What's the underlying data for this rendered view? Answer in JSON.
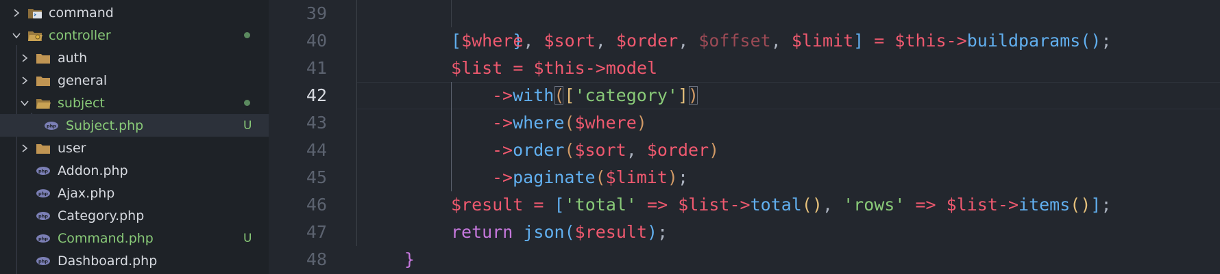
{
  "sidebar": {
    "items": [
      {
        "label": "command",
        "type": "folder",
        "open": false,
        "level": 0,
        "badge": ""
      },
      {
        "label": "controller",
        "type": "folder",
        "open": true,
        "level": 0,
        "badge": "dot"
      },
      {
        "label": "auth",
        "type": "folder",
        "open": false,
        "level": 1,
        "badge": ""
      },
      {
        "label": "general",
        "type": "folder",
        "open": false,
        "level": 1,
        "badge": ""
      },
      {
        "label": "subject",
        "type": "folder",
        "open": true,
        "level": 1,
        "badge": "dot"
      },
      {
        "label": "Subject.php",
        "type": "php",
        "level": 2,
        "badge": "U",
        "active": true
      },
      {
        "label": "user",
        "type": "folder",
        "open": false,
        "level": 1,
        "badge": ""
      },
      {
        "label": "Addon.php",
        "type": "php",
        "level": 1,
        "badge": ""
      },
      {
        "label": "Ajax.php",
        "type": "php",
        "level": 1,
        "badge": ""
      },
      {
        "label": "Category.php",
        "type": "php",
        "level": 1,
        "badge": ""
      },
      {
        "label": "Command.php",
        "type": "php",
        "level": 1,
        "badge": "U"
      },
      {
        "label": "Dashboard.php",
        "type": "php",
        "level": 1,
        "badge": ""
      }
    ]
  },
  "editor": {
    "current_line": "42",
    "lines": [
      {
        "number": "39",
        "text": "}"
      },
      {
        "number": "40",
        "text": "[$where, $sort, $order, $offset, $limit] = $this->buildparams();"
      },
      {
        "number": "41",
        "text": "$list = $this->model"
      },
      {
        "number": "42",
        "text": "->with(['category'])"
      },
      {
        "number": "43",
        "text": "->where($where)"
      },
      {
        "number": "44",
        "text": "->order($sort, $order)"
      },
      {
        "number": "45",
        "text": "->paginate($limit);"
      },
      {
        "number": "46",
        "text": "$result = ['total' => $list->total(), 'rows' => $list->items()];"
      },
      {
        "number": "47",
        "text": "return json($result);"
      },
      {
        "number": "48",
        "text": "}"
      }
    ],
    "tokens": {
      "this": "$this",
      "arrow": "->",
      "eq": "=",
      "fat_arrow": "=>",
      "semi": ";",
      "comma": ",",
      "v_where": "$where",
      "v_sort": "$sort",
      "v_order": "$order",
      "v_offset": "$offset",
      "v_limit": "$limit",
      "v_list": "$list",
      "v_result": "$result",
      "f_buildparams": "buildparams",
      "f_model": "model",
      "f_with": "with",
      "f_where": "where",
      "f_order": "order",
      "f_paginate": "paginate",
      "f_total": "total",
      "f_items": "items",
      "f_json": "json",
      "kw_return": "return",
      "s_category": "'category'",
      "s_total": "'total'",
      "s_rows": "'rows'",
      "brace_close": "}",
      "lb": "[",
      "rb": "]",
      "lp": "(",
      "rp": ")"
    }
  }
}
